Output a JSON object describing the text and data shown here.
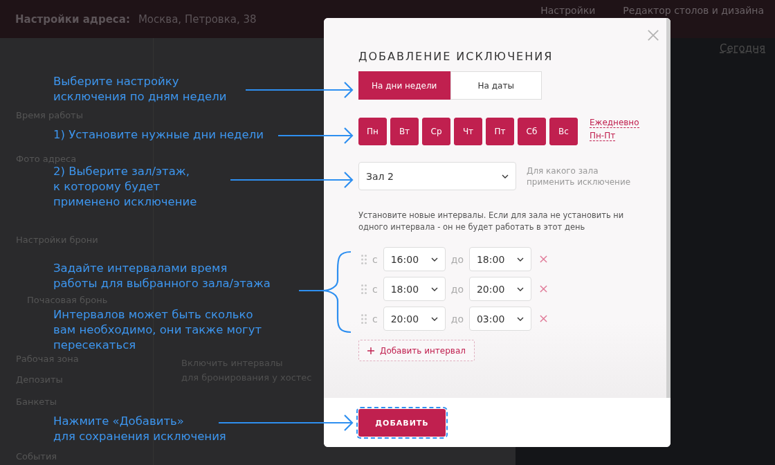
{
  "header": {
    "title": "Настройки адреса:",
    "address": "Москва, Петровка, 38",
    "actions": [
      "Настройки",
      "Редактор столов и дизайна"
    ]
  },
  "sidebar": {
    "items": [
      {
        "label": "Время работы"
      },
      {
        "label": "Фото адреса"
      },
      {
        "label": "Настройки брони"
      },
      {
        "label": "Почасовая бронь"
      },
      {
        "label": "Рабочая зона"
      },
      {
        "label": "Депозиты"
      },
      {
        "label": "Банкеты"
      },
      {
        "label": "События"
      }
    ]
  },
  "main": {
    "setting_text": "Включить интервалы\nдля бронирования у хостес"
  },
  "map": {
    "today_link": "Сегодня"
  },
  "modal": {
    "title": "ДОБАВЛЕНИЕ ИСКЛЮЧЕНИЯ",
    "tabs": [
      {
        "label": "На дни недели",
        "selected": true
      },
      {
        "label": "На даты",
        "selected": false
      }
    ],
    "days": [
      {
        "label": "Пн",
        "selected": true
      },
      {
        "label": "Вт",
        "selected": true
      },
      {
        "label": "Ср",
        "selected": true
      },
      {
        "label": "Чт",
        "selected": true
      },
      {
        "label": "Пт",
        "selected": true
      },
      {
        "label": "Сб",
        "selected": true
      },
      {
        "label": "Вс",
        "selected": true
      }
    ],
    "day_presets": [
      "Ежедневно",
      "Пн-Пт"
    ],
    "hall_select": {
      "value": "Зал 2"
    },
    "hall_hint": "Для какого зала\nприменить исключение",
    "intervals_hint": "Установите новые интервалы. Если для зала не установить ни одного интервала - он не будет работать в этот день",
    "intervals": [
      {
        "from_label": "с",
        "from": "16:00",
        "to_label": "до",
        "to": "18:00"
      },
      {
        "from_label": "с",
        "from": "18:00",
        "to_label": "до",
        "to": "20:00"
      },
      {
        "from_label": "с",
        "from": "20:00",
        "to_label": "до",
        "to": "03:00"
      }
    ],
    "add_interval_button": "Добавить интервал",
    "add_button": "ДОБАВИТЬ"
  },
  "annotations": [
    {
      "text": "Выберите настройку\nисключения по дням недели"
    },
    {
      "text": "1) Установите нужные дни недели"
    },
    {
      "text": "2) Выберите зал/этаж,\nк которому будет\nприменено исключение"
    },
    {
      "text": "Задайте интервалами время\nработы для выбранного зала/этажа"
    },
    {
      "text": "Интервалов может быть сколько\nвам необходимо, они также могут\nпересекаться"
    },
    {
      "text": "Нажмите «Добавить»\nдля сохранения исключения"
    }
  ]
}
